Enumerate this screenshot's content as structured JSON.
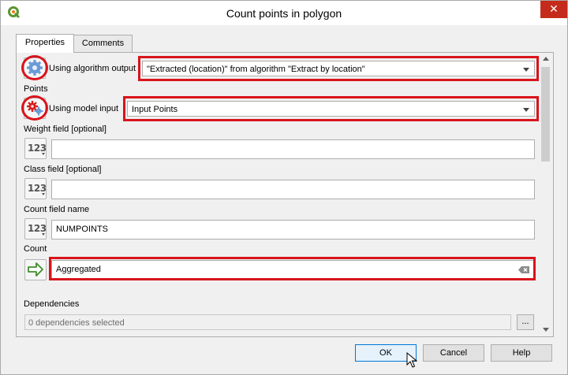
{
  "window": {
    "title": "Count points in polygon",
    "close_glyph": "✕",
    "app_icon": "qgis-icon"
  },
  "tabs": [
    {
      "label": "Properties",
      "active": true
    },
    {
      "label": "Comments",
      "active": false
    }
  ],
  "polygons": {
    "source_label": "Using algorithm output",
    "source_icon": "gear-icon",
    "value": "\"Extracted (location)\" from algorithm \"Extract by location\""
  },
  "points": {
    "label": "Points",
    "source_label": "Using model input",
    "source_icon": "model-input-icon",
    "value": "Input Points"
  },
  "weight_field": {
    "label": "Weight field [optional]",
    "value": "",
    "icon_text": "123"
  },
  "class_field": {
    "label": "Class field [optional]",
    "value": "",
    "icon_text": "123"
  },
  "count_field_name": {
    "label": "Count field name",
    "value": "NUMPOINTS",
    "icon_text": "123"
  },
  "count": {
    "label": "Count",
    "value": "Aggregated",
    "icon": "output-arrow-icon"
  },
  "dependencies": {
    "label": "Dependencies",
    "value": "0 dependencies selected",
    "browse_label": "..."
  },
  "buttons": {
    "ok": "OK",
    "cancel": "Cancel",
    "help": "Help"
  },
  "colors": {
    "highlight": "#d8141c",
    "close_button": "#c42b1c",
    "primary_border": "#0078d7"
  }
}
